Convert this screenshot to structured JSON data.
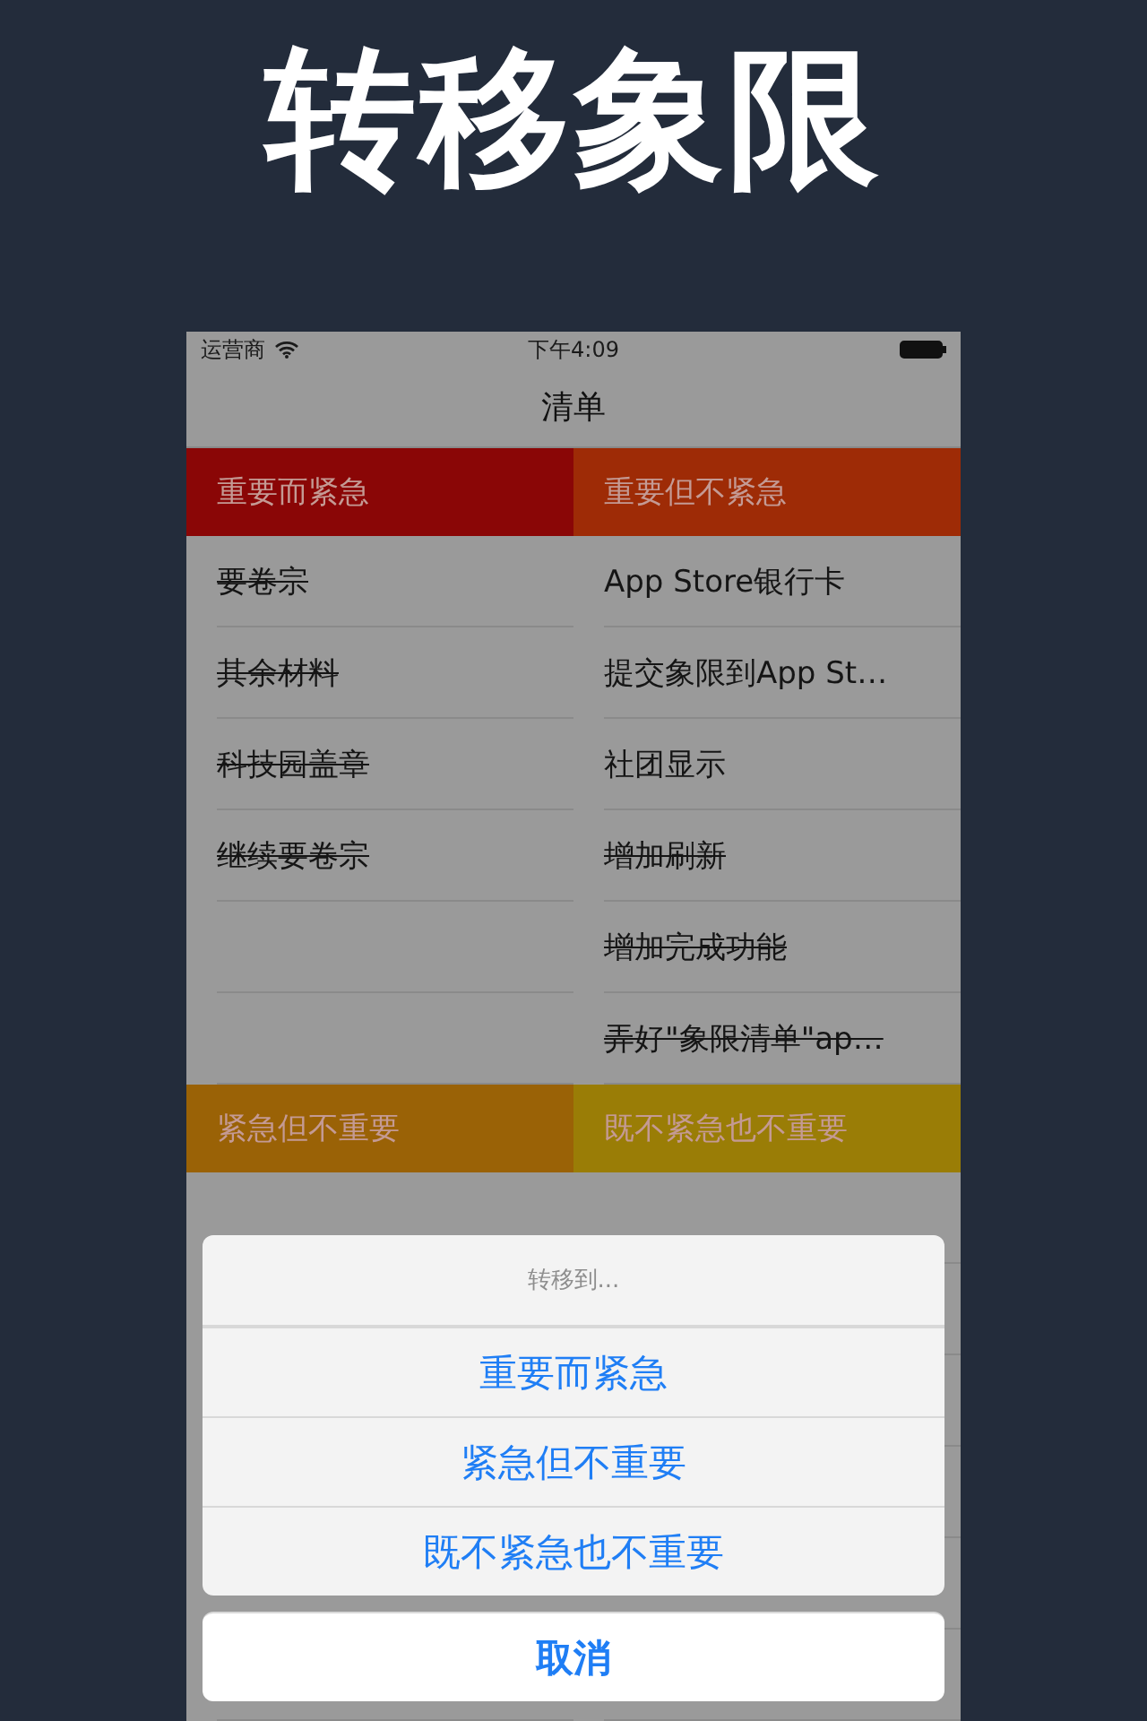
{
  "headline": "转移象限",
  "status_bar": {
    "carrier": "运营商",
    "time": "下午4:09"
  },
  "nav": {
    "title": "清单"
  },
  "quadrants": [
    {
      "title": "重要而紧急",
      "color": "#8a0606",
      "items": [
        {
          "text": "要卷宗",
          "done": true
        },
        {
          "text": "其余材料",
          "done": true
        },
        {
          "text": "科技园盖章",
          "done": true
        },
        {
          "text": "继续要卷宗",
          "done": true
        }
      ]
    },
    {
      "title": "重要但不紧急",
      "color": "#9e2b06",
      "items": [
        {
          "text": "App Store银行卡",
          "done": false
        },
        {
          "text": "提交象限到App St…",
          "done": false
        },
        {
          "text": "社团显示",
          "done": false
        },
        {
          "text": "增加刷新",
          "done": true
        },
        {
          "text": "增加完成功能",
          "done": true
        },
        {
          "text": "弄好\"象限清单\"ap…",
          "done": true
        }
      ]
    },
    {
      "title": "紧急但不重要",
      "color": "#9a6206"
    },
    {
      "title": "既不紧急也不重要",
      "color": "#9a7d06"
    }
  ],
  "action_sheet": {
    "title": "转移到...",
    "options": [
      "重要而紧急",
      "紧急但不重要",
      "既不紧急也不重要"
    ],
    "cancel": "取消"
  }
}
